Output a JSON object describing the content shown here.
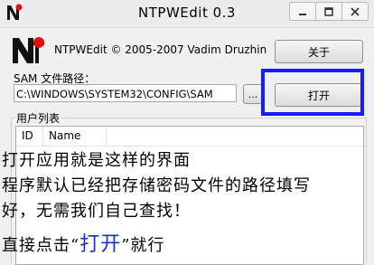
{
  "window": {
    "title": "NTPWEdit 0.3",
    "buttons": [
      "minimize",
      "maximize",
      "close"
    ]
  },
  "header": {
    "copyright": "NTPWEdit © 2005-2007 Vadim Druzhin",
    "about_label": "关于"
  },
  "sam": {
    "label": "SAM 文件路径：",
    "path": "C:\\WINDOWS\\SYSTEM32\\CONFIG\\SAM",
    "browse_label": "...",
    "open_label": "打开"
  },
  "users": {
    "group_label": "用户列表",
    "columns": [
      "ID",
      "Name"
    ]
  },
  "annotation": {
    "line1": "打开应用就是这样的界面",
    "line2": "程序默认已经把存储密码文件的路径填写",
    "line3": "好，无需我们自己查找！",
    "line4_prefix": "直接点击“",
    "line4_highlight": "打开",
    "line4_suffix": "”就行"
  },
  "colors": {
    "highlight_box": "#1a1aff",
    "highlight_text": "#1a2fd0"
  }
}
